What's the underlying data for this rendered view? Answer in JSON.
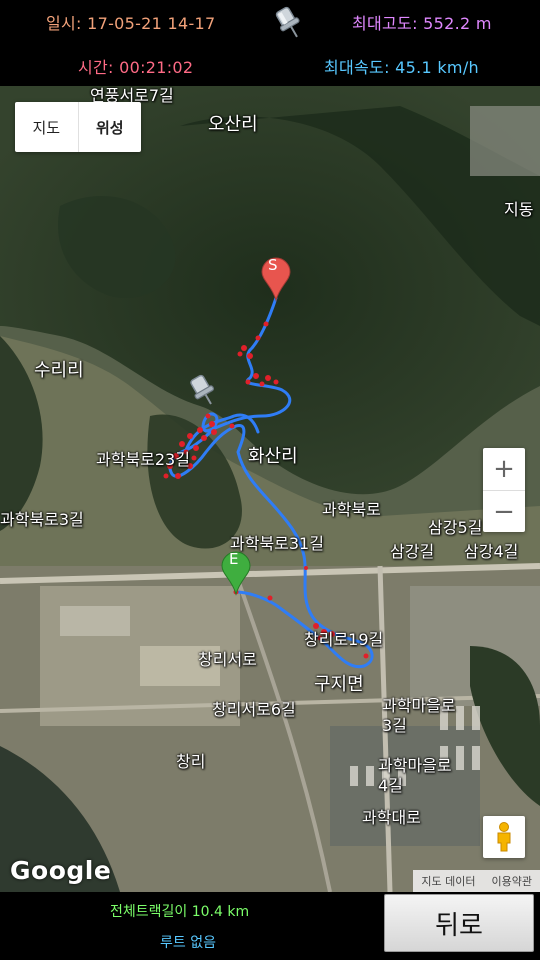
{
  "header": {
    "datetime": "일시: 17-05-21 14-17",
    "duration": "시간: 00:21:02",
    "max_altitude": "최대고도: 552.2 m",
    "max_speed": "최대속도: 45.1 km/h",
    "pin_icon": "pushpin-icon"
  },
  "map": {
    "type_toggle": {
      "map_label": "지도",
      "satellite_label": "위성",
      "selected": "위성"
    },
    "zoom": {
      "in_label": "+",
      "out_label": "−"
    },
    "street_view_icon": "pegman-icon",
    "logo": "Google",
    "attribution": {
      "data_label": "지도 데이터",
      "terms_label": "이용약관"
    },
    "markers": {
      "start_label": "S",
      "end_label": "E",
      "start_color": "#e8554e",
      "end_color": "#3fae3f"
    },
    "track_colors": {
      "line": "#2f7df6",
      "points": "#e0202a"
    },
    "place_labels": [
      "연풍서로7길",
      "오산리",
      "지동",
      "수리리",
      "과학북로23길",
      "화산리",
      "과학북로",
      "과학북로3길",
      "삼강5길",
      "과학북로31길",
      "삼강길",
      "삼강4길",
      "창리로19길",
      "창리서로",
      "구지면",
      "과학마을로3길",
      "창리서로6길",
      "창리",
      "과학마을로4길",
      "과학대로"
    ]
  },
  "footer": {
    "total_distance": "전체트랙길이 10.4 km",
    "route_status": "루트 없음",
    "back_label": "뒤로"
  }
}
